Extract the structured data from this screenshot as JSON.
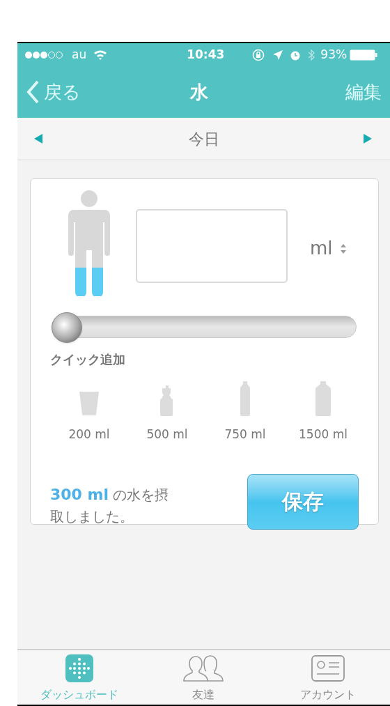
{
  "status_bar": {
    "carrier": "au",
    "time": "10:43",
    "battery": "93%"
  },
  "nav": {
    "back": "戻る",
    "title": "水",
    "action": "編集"
  },
  "date_nav": {
    "label": "今日"
  },
  "entry": {
    "unit": "ml",
    "slider": {
      "level": 0
    }
  },
  "quick_add": {
    "title": "クイック追加",
    "items": [
      {
        "kind": "cup",
        "label": "200 ml"
      },
      {
        "kind": "sport-bottle",
        "label": "500 ml"
      },
      {
        "kind": "bottle",
        "label": "750 ml"
      },
      {
        "kind": "large-bottle",
        "label": "1500 ml"
      }
    ]
  },
  "summary": {
    "amount": "300 ml",
    "text": "の水を摂取しました。"
  },
  "save_button": "保存",
  "tabs": [
    {
      "kind": "dashboard",
      "label": "ダッシュボード",
      "selected": true
    },
    {
      "kind": "friends",
      "label": "友達",
      "selected": false
    },
    {
      "kind": "account",
      "label": "アカウント",
      "selected": false
    }
  ]
}
